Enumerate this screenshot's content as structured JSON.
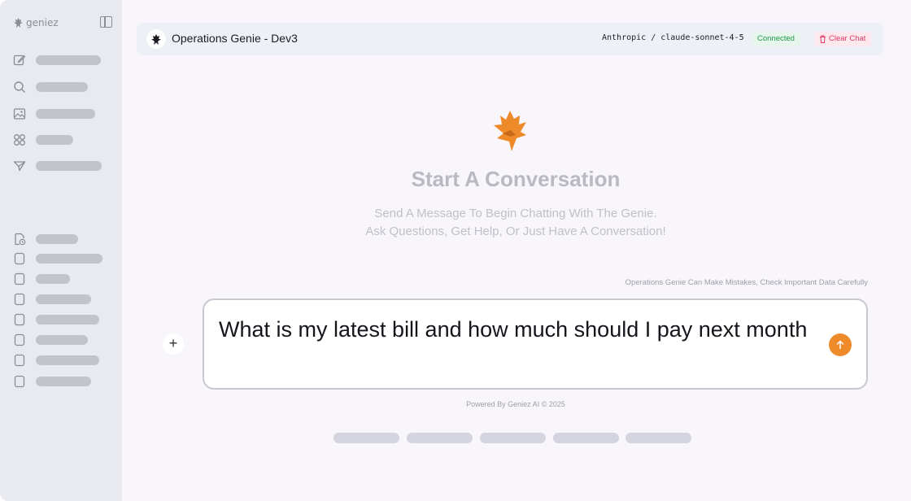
{
  "sidebar": {
    "brand": "geniez",
    "nav_icons": [
      "edit-icon",
      "search-icon",
      "image-icon",
      "apps-icon",
      "send-icon"
    ],
    "history_icons": [
      "file-clock-icon",
      "chat-icon",
      "chat-icon",
      "chat-icon",
      "chat-icon",
      "chat-icon",
      "chat-icon",
      "chat-icon"
    ]
  },
  "header": {
    "title": "Operations Genie - Dev3",
    "model": "Anthropic / claude-sonnet-4-5",
    "status": "Connected",
    "clear_label": "Clear Chat"
  },
  "empty_state": {
    "title": "Start A Conversation",
    "subtitle_line1": "Send A Message To Begin Chatting With The Genie.",
    "subtitle_line2": "Ask Questions, Get Help, Or Just Have A Conversation!"
  },
  "composer": {
    "disclaimer": "Operations Genie Can Make Mistakes, Check Important Data Carefully",
    "attach_label": "+",
    "input_value": "What is my latest bill and how much should I pay next month"
  },
  "footer": {
    "text": "Powered By Geniez AI © 2025"
  },
  "colors": {
    "accent": "#ef8a2b",
    "connected": "#1f9a4a",
    "danger": "#e0366a"
  }
}
